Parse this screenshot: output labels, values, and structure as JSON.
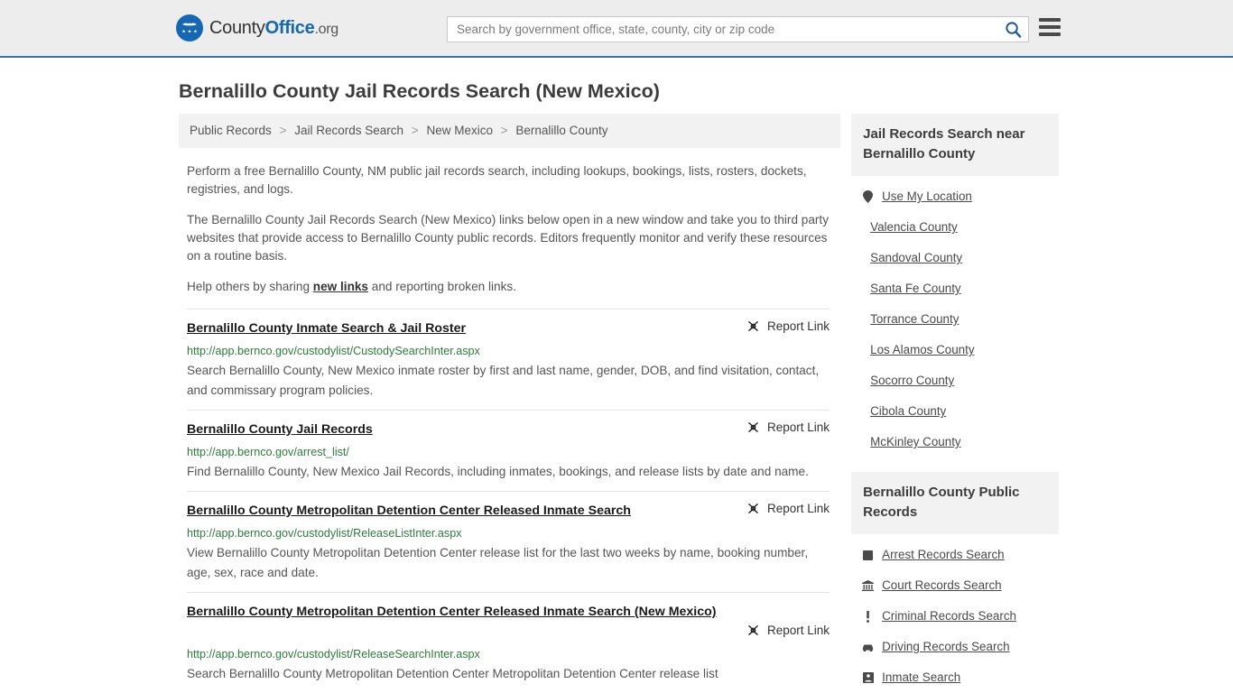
{
  "header": {
    "logo": {
      "icon": "eagle-shield-icon",
      "text_county": "County",
      "text_office": "Office",
      "text_org": ".org"
    },
    "search": {
      "placeholder": "Search by government office, state, county, city or zip code",
      "value": "",
      "search_icon": "search-icon"
    },
    "menu_icon": "hamburger-menu-icon"
  },
  "page": {
    "title": "Bernalillo County Jail Records Search (New Mexico)"
  },
  "breadcrumb": {
    "items": [
      {
        "label": "Public Records"
      },
      {
        "label": "Jail Records Search"
      },
      {
        "label": "New Mexico"
      },
      {
        "label": "Bernalillo County"
      }
    ],
    "separator": ">"
  },
  "intro": {
    "p1": "Perform a free Bernalillo County, NM public jail records search, including lookups, bookings, lists, rosters, dockets, registries, and logs.",
    "p2": "The Bernalillo County Jail Records Search (New Mexico) links below open in a new window and take you to third party websites that provide access to Bernalillo County public records. Editors frequently monitor and verify these resources on a routine basis.",
    "p3_before": "Help others by sharing ",
    "p3_link": "new links",
    "p3_after": " and reporting broken links."
  },
  "report_link_label": "Report Link",
  "report_link_icon": "broken-link-icon",
  "results": [
    {
      "title": "Bernalillo County Inmate Search & Jail Roster",
      "url": "http://app.bernco.gov/custodylist/CustodySearchInter.aspx",
      "description": "Search Bernalillo County, New Mexico inmate roster by first and last name, gender, DOB, and find visitation, contact, and commissary program policies."
    },
    {
      "title": "Bernalillo County Jail Records",
      "url": "http://app.bernco.gov/arrest_list/",
      "description": "Find Bernalillo County, New Mexico Jail Records, including inmates, bookings, and release lists by date and name."
    },
    {
      "title": "Bernalillo County Metropolitan Detention Center Released Inmate Search",
      "url": "http://app.bernco.gov/custodylist/ReleaseListInter.aspx",
      "description": "View Bernalillo County Metropolitan Detention Center release list for the last two weeks by name, booking number, age, sex, race and date."
    },
    {
      "title": "Bernalillo County Metropolitan Detention Center Released Inmate Search (New Mexico)",
      "url": "http://app.bernco.gov/custodylist/ReleaseSearchInter.aspx",
      "description": "Search Bernalillo County Metropolitan Detention Center Metropolitan Detention Center release list"
    }
  ],
  "sidebar": {
    "nearby": {
      "heading": "Jail Records Search near Bernalillo County",
      "items": [
        {
          "label": "Use My Location",
          "icon": "map-pin-icon"
        },
        {
          "label": "Valencia County",
          "icon": ""
        },
        {
          "label": "Sandoval County",
          "icon": ""
        },
        {
          "label": "Santa Fe County",
          "icon": ""
        },
        {
          "label": "Torrance County",
          "icon": ""
        },
        {
          "label": "Los Alamos County",
          "icon": ""
        },
        {
          "label": "Socorro County",
          "icon": ""
        },
        {
          "label": "Cibola County",
          "icon": ""
        },
        {
          "label": "McKinley County",
          "icon": ""
        }
      ]
    },
    "public_records": {
      "heading": "Bernalillo County Public Records",
      "items": [
        {
          "label": "Arrest Records Search",
          "icon": "square-icon"
        },
        {
          "label": "Court Records Search",
          "icon": "courthouse-icon"
        },
        {
          "label": "Criminal Records Search",
          "icon": "exclamation-icon"
        },
        {
          "label": "Driving Records Search",
          "icon": "car-icon"
        },
        {
          "label": "Inmate Search",
          "icon": "id-card-icon"
        }
      ]
    }
  },
  "colors": {
    "brand_blue": "#1567b3",
    "header_bg": "#ededed",
    "header_border": "#3b73ad",
    "url_green": "#2f7a3d",
    "panel_gray": "#f2f2f2",
    "text_gray": "#555555"
  }
}
